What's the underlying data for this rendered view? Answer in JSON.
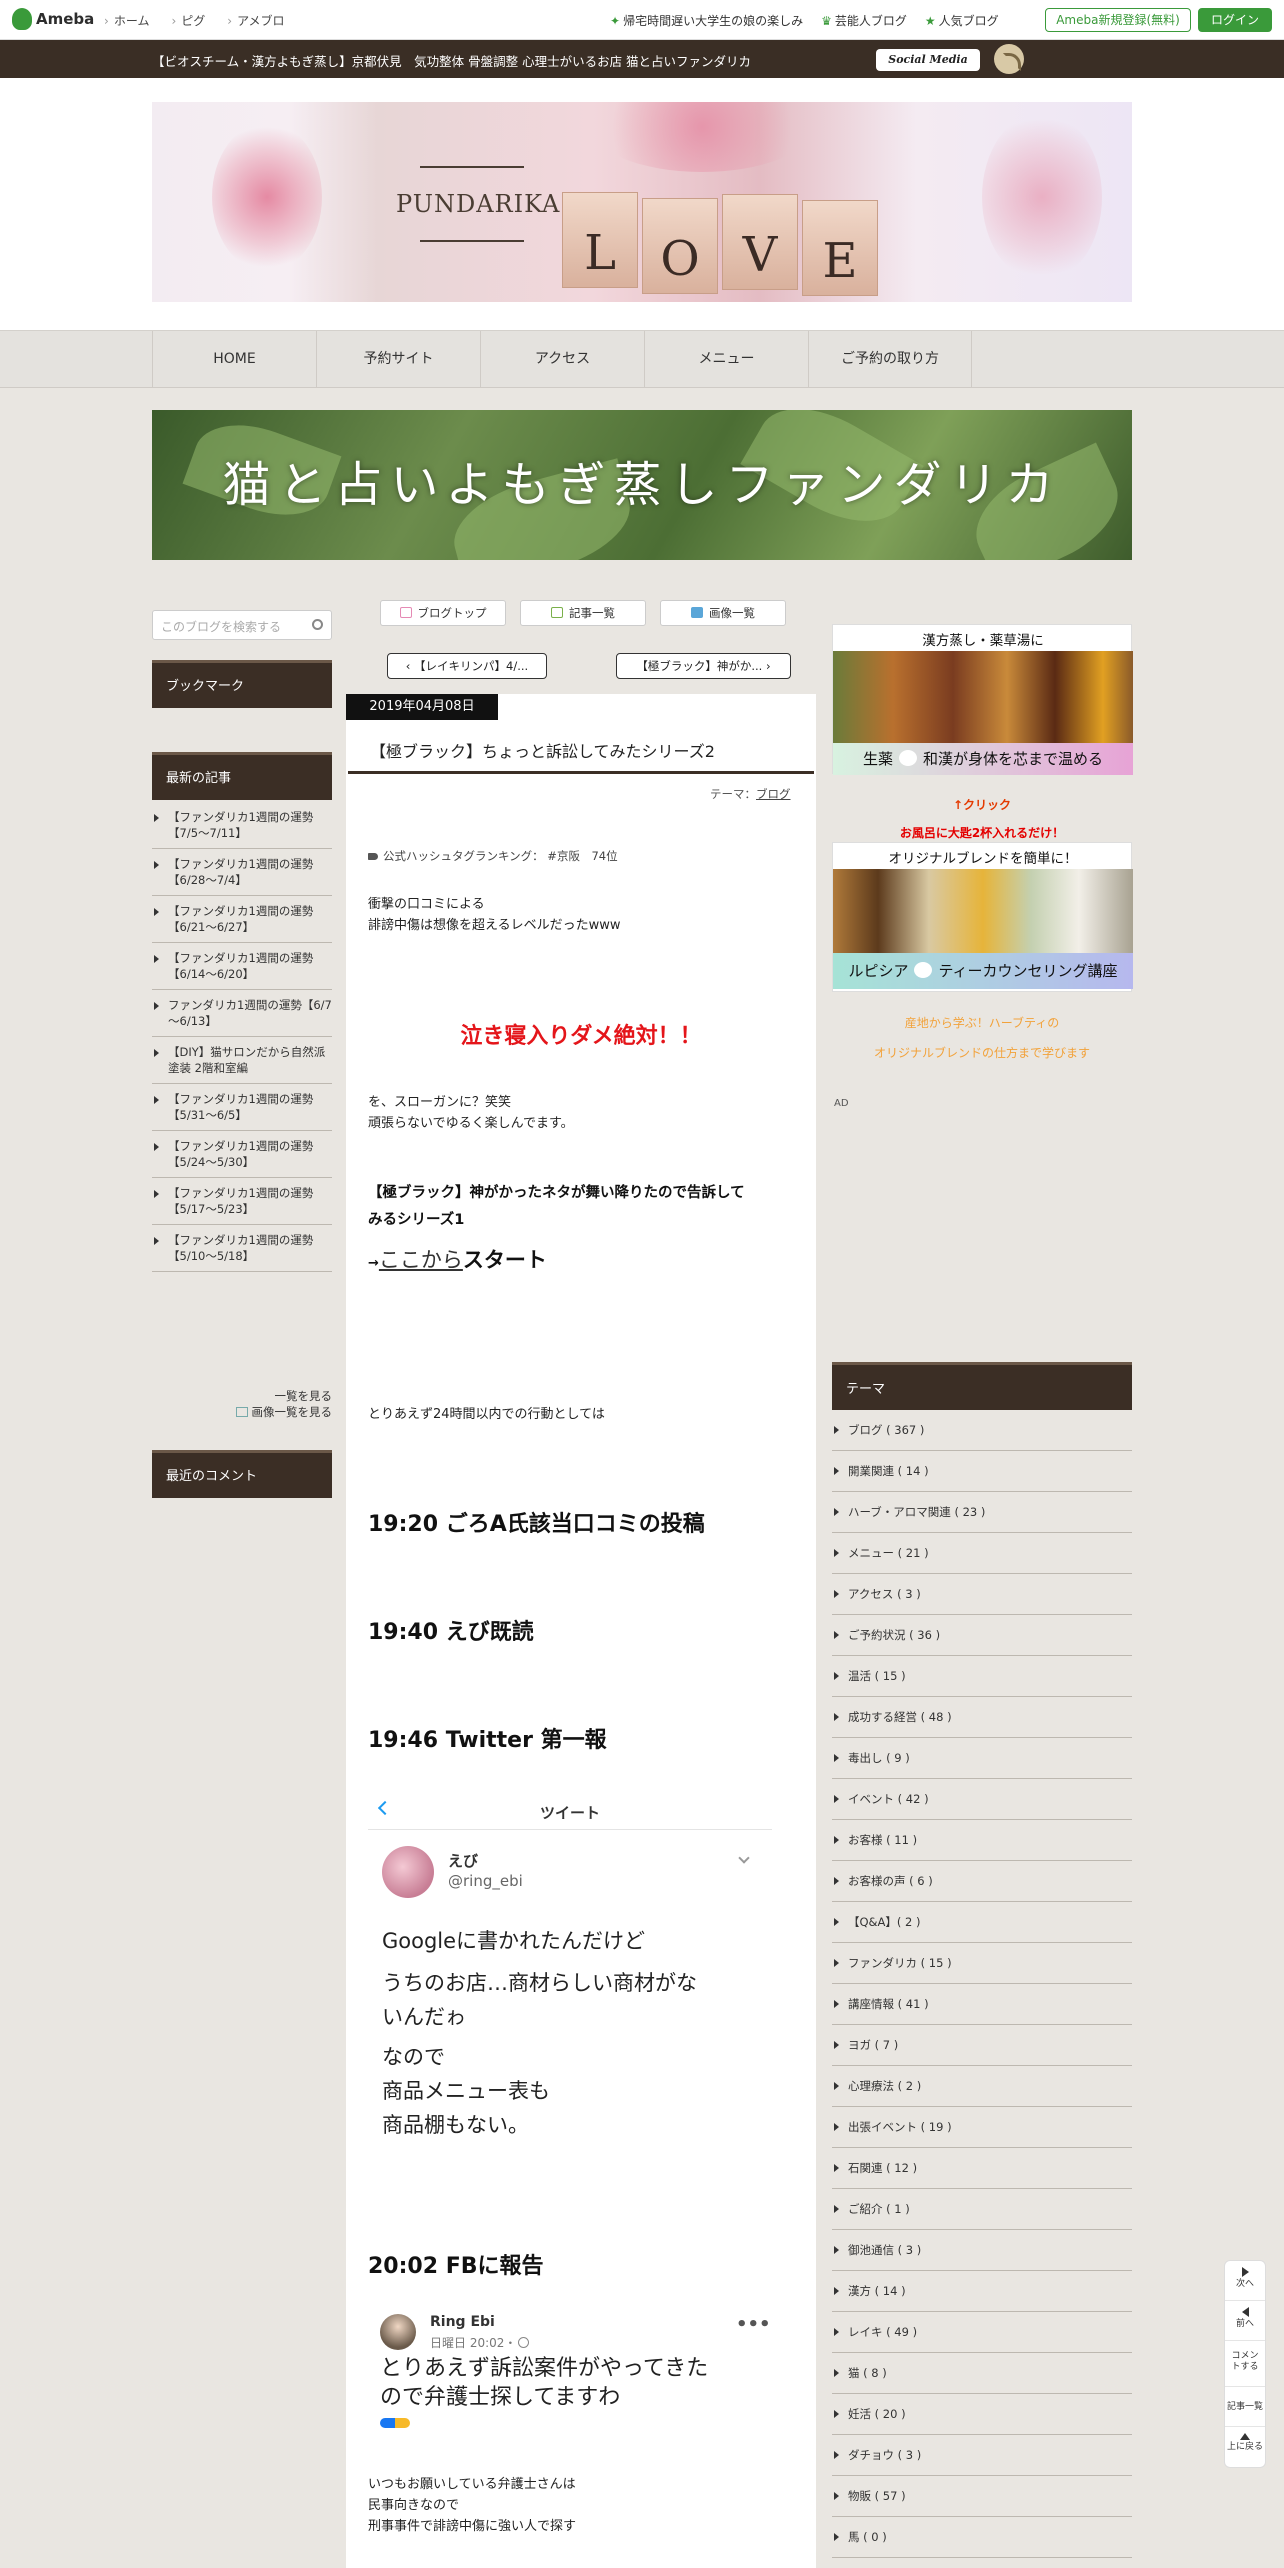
{
  "topbar": {
    "logo": "Ameba",
    "nav": [
      "ホーム",
      "ピグ",
      "アメブロ"
    ],
    "links": [
      "帰宅時間遅い大学生の娘の楽しみ",
      "芸能人ブログ",
      "人気ブログ"
    ],
    "register": "Ameba新規登録(無料)",
    "login": "ログイン"
  },
  "titlebar": {
    "description": "【ビオスチーム・漢方よもぎ蒸し】京都伏見　気功整体 骨盤調整 心理士がいるお店 猫と占いファンダリカ",
    "social": "Social Media"
  },
  "header": {
    "logo_text": "PUNDARIKA",
    "love": [
      "L",
      "O",
      "V",
      "E"
    ]
  },
  "nav": [
    "HOME",
    "予約サイト",
    "アクセス",
    "メニュー",
    "ご予約の取り方"
  ],
  "banner_title": "猫と占いよもぎ蒸しファンダリカ",
  "left": {
    "search_placeholder": "このブログを検索する",
    "bookmark": "ブックマーク",
    "recent_title": "最新の記事",
    "recent": [
      "【ファンダリカ1週間の運勢【7/5～7/11】",
      "【ファンダリカ1週間の運勢【6/28～7/4】",
      "【ファンダリカ1週間の運勢【6/21～6/27】",
      "【ファンダリカ1週間の運勢【6/14～6/20】",
      "ファンダリカ1週間の運勢【6/7～6/13】",
      "【DIY】猫サロンだから自然派塗装 2階和室編",
      "【ファンダリカ1週間の運勢【5/31～6/5】",
      "【ファンダリカ1週間の運勢【5/24～5/30】",
      "【ファンダリカ1週間の運勢【5/17～5/23】",
      "【ファンダリカ1週間の運勢【5/10～5/18】"
    ],
    "see_all": "一覧を見る",
    "see_images": "画像一覧を見る",
    "comments_title": "最近のコメント"
  },
  "center": {
    "tabs": [
      "ブログトップ",
      "記事一覧",
      "画像一覧"
    ],
    "prev": "‹ 【レイキリンパ】4/...",
    "next": "【極ブラック】神がか... ›",
    "date": "2019年04月08日",
    "title": "【極ブラック】ちょっと訴訟してみたシリーズ2",
    "theme_label": "テーマ：",
    "theme": "ブログ",
    "hashtag": "公式ハッシュタグランキング：  #京阪　74位",
    "p1": [
      "衝撃の口コミによる",
      "誹謗中傷は想像を超えるレベルだったwww"
    ],
    "red": "泣き寝入りダメ絶対！！",
    "p2": [
      "を、スローガンに？笑笑",
      "頑張らないでゆるく楽しんでます。"
    ],
    "bold1": [
      "【極ブラック】神がかったネタが舞い降りたので告訴して",
      "みるシリーズ1"
    ],
    "start_prefix": "→",
    "start_link": "ここから",
    "start_suffix": "スタート",
    "p3": "とりあえず24時間以内での行動としては",
    "h1": "19:20 ごろA氏該当口コミの投稿",
    "h2": "19:40 えび既読",
    "h3": "19:46 Twitter 第一報",
    "tweet": {
      "header": "ツイート",
      "name": "えび",
      "handle": "@ring_ebi",
      "lines": [
        "Googleに書かれたんだけど",
        "うちのお店…商材らしい商材がな",
        "いんだゎ",
        "なので",
        "商品メニュー表も",
        "商品棚もない。"
      ]
    },
    "h4": "20:02 FBに報告",
    "fb": {
      "name": "Ring Ebi",
      "time": "日曜日 20:02・",
      "lines": [
        "とりあえず訴訟案件がやってきた",
        "ので弁護士探してますわ"
      ]
    },
    "p4": [
      "いつもお願いしている弁護士さんは",
      "民事向きなので",
      "刑事事件で誹謗中傷に強い人で探す"
    ]
  },
  "right": {
    "ad1_title": "漢方蒸し・薬草湯に",
    "ad1_bottom_a": "生薬",
    "ad1_bottom_b": "和漢が身体を芯まで温める",
    "click": "↑クリック",
    "ad2_red": "お風呂に大匙2杯入れるだけ！",
    "ad2_title": "オリジナルブレンドを簡単に！",
    "ad2_bottom_a": "ルピシア",
    "ad2_bottom_b": "ティーカウンセリング講座",
    "ad2_or1": "産地から学ぶ！ハーブティの",
    "ad2_or2": "オリジナルブレンドの仕方まで学びます",
    "ad_label": "AD",
    "theme_title": "テーマ",
    "themes": [
      "ブログ ( 367 )",
      "開業関連 ( 14 )",
      "ハーブ・アロマ関連 ( 23 )",
      "メニュー ( 21 )",
      "アクセス ( 3 )",
      "ご予約状況 ( 36 )",
      "温活 ( 15 )",
      "成功する経営 ( 48 )",
      "毒出し ( 9 )",
      "イベント ( 42 )",
      "お客様 ( 11 )",
      "お客様の声 ( 6 )",
      "【Q&A】( 2 )",
      "ファンダリカ ( 15 )",
      "講座情報 ( 41 )",
      "ヨガ ( 7 )",
      "心理療法 ( 2 )",
      "出張イベント ( 19 )",
      "石関連 ( 12 )",
      "ご紹介 ( 1 )",
      "御池通信 ( 3 )",
      "漢方 ( 14 )",
      "レイキ ( 49 )",
      "猫 ( 8 )",
      "妊活 ( 20 )",
      "ダチョウ ( 3 )",
      "物販 ( 57 )",
      "馬 ( 0 )"
    ]
  },
  "floating": [
    "次へ",
    "前へ",
    "コメントする",
    "記事一覧",
    "上に戻る"
  ]
}
